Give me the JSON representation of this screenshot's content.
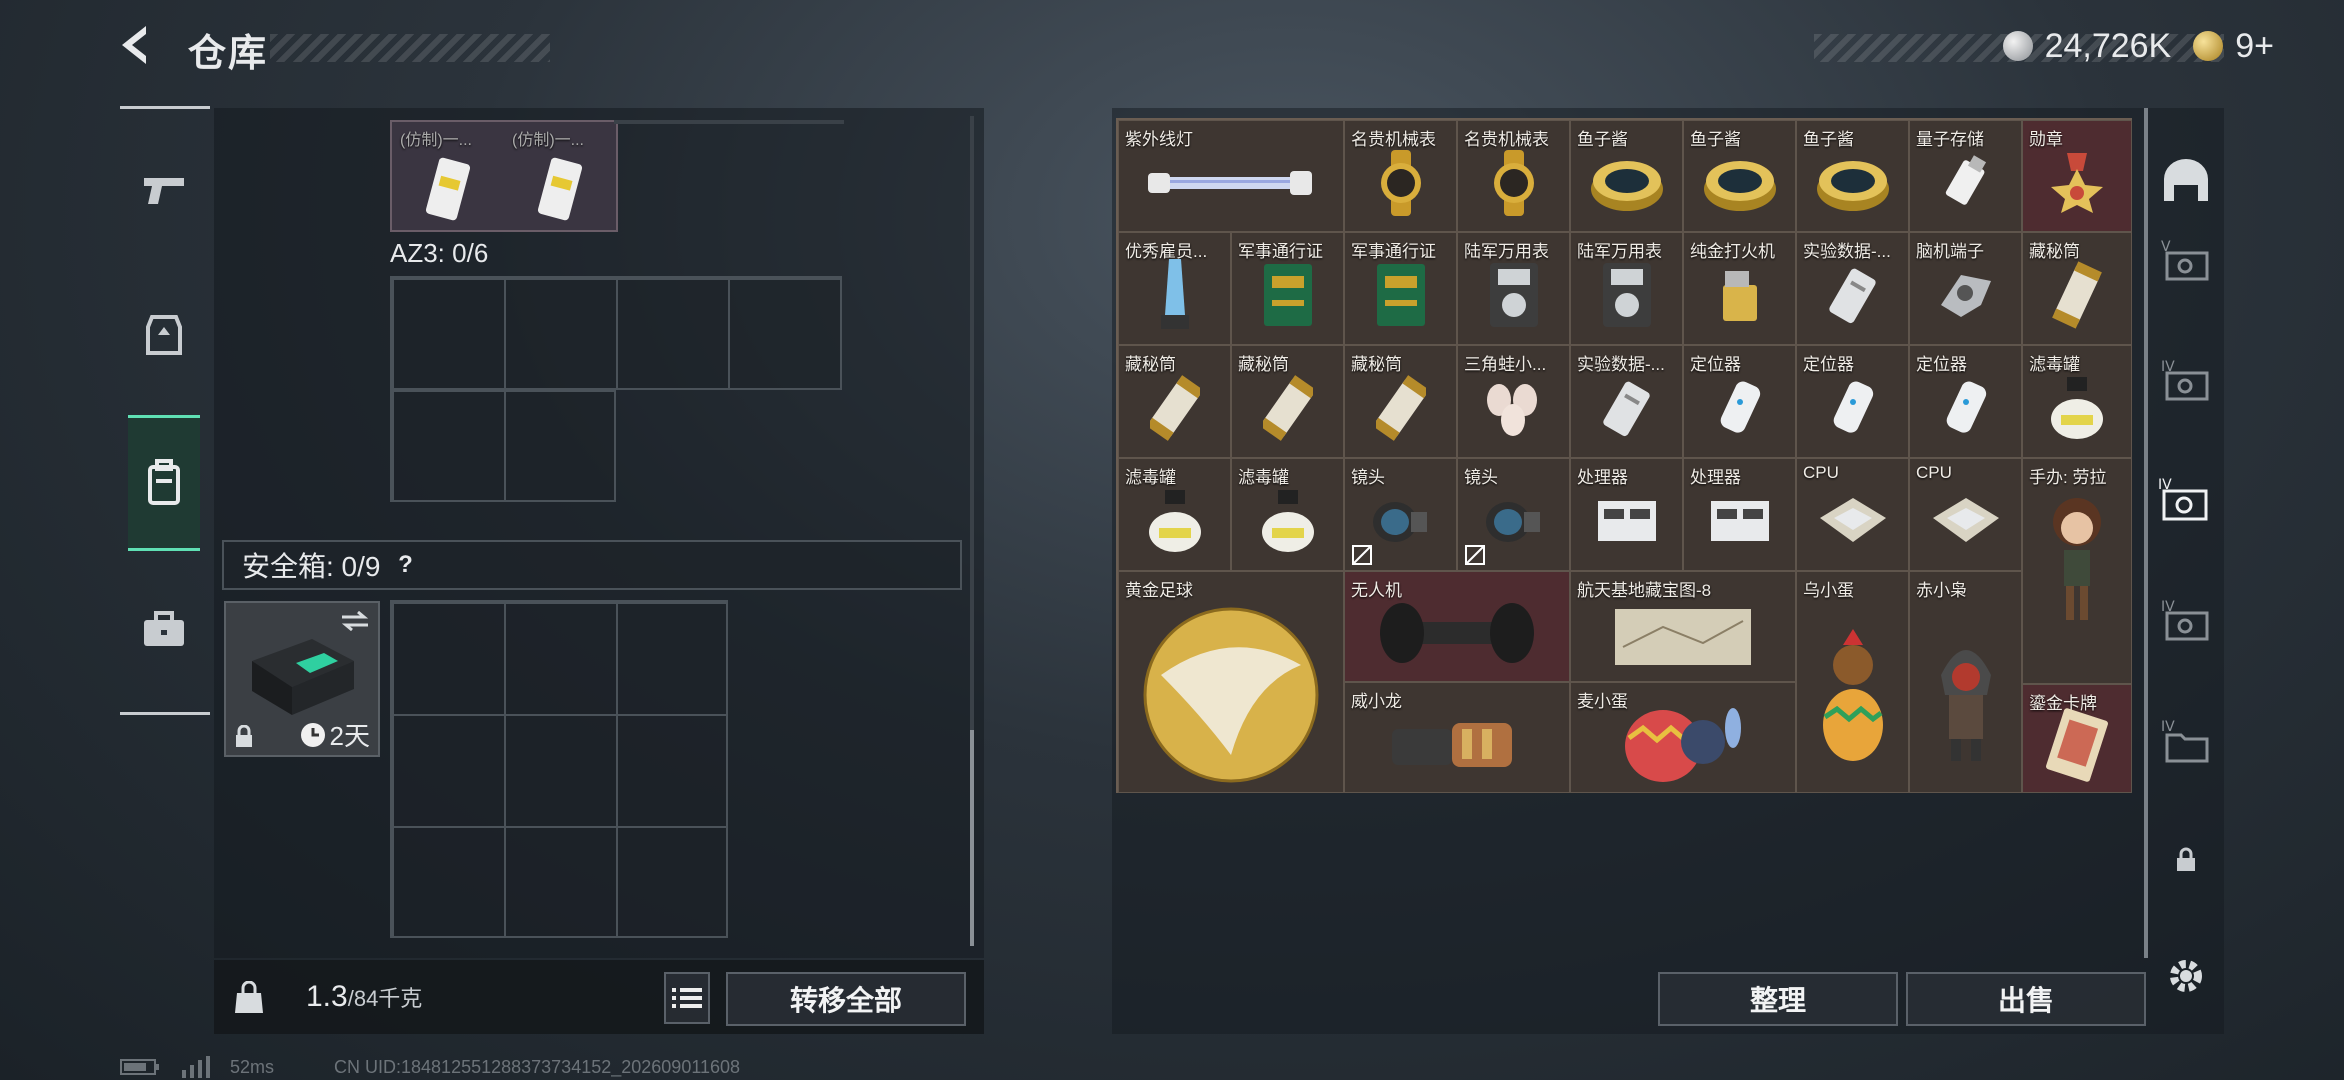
{
  "header": {
    "title": "仓库",
    "silver_amount": "24,726K",
    "gold_amount": "9+"
  },
  "left": {
    "top_items": [
      {
        "label": "(仿制)一..."
      },
      {
        "label": "(仿制)一..."
      }
    ],
    "az3_label": "AZ3: 0/6",
    "safe_label": "安全箱: 0/9",
    "safe_help": "?",
    "safe_timer": "2天",
    "weight_value": "1.3",
    "weight_max": "/84千克",
    "transfer_all": "转移全部"
  },
  "inventory": {
    "items": [
      {
        "name": "紫外线灯"
      },
      {
        "name": "名贵机械表"
      },
      {
        "name": "名贵机械表"
      },
      {
        "name": "鱼子酱"
      },
      {
        "name": "鱼子酱"
      },
      {
        "name": "鱼子酱"
      },
      {
        "name": "量子存储"
      },
      {
        "name": "勋章"
      },
      {
        "name": "优秀雇员..."
      },
      {
        "name": "军事通行证"
      },
      {
        "name": "军事通行证"
      },
      {
        "name": "陆军万用表"
      },
      {
        "name": "陆军万用表"
      },
      {
        "name": "纯金打火机"
      },
      {
        "name": "实验数据-..."
      },
      {
        "name": "脑机端子"
      },
      {
        "name": "藏秘筒"
      },
      {
        "name": "藏秘筒"
      },
      {
        "name": "藏秘筒"
      },
      {
        "name": "藏秘筒"
      },
      {
        "name": "三角蛙小..."
      },
      {
        "name": "实验数据-..."
      },
      {
        "name": "定位器"
      },
      {
        "name": "定位器"
      },
      {
        "name": "定位器"
      },
      {
        "name": "滤毒罐"
      },
      {
        "name": "滤毒罐"
      },
      {
        "name": "滤毒罐"
      },
      {
        "name": "镜头"
      },
      {
        "name": "镜头"
      },
      {
        "name": "处理器"
      },
      {
        "name": "处理器"
      },
      {
        "name": "CPU"
      },
      {
        "name": "CPU"
      },
      {
        "name": "手办: 劳拉"
      },
      {
        "name": "黄金足球"
      },
      {
        "name": "无人机"
      },
      {
        "name": "航天基地藏宝图-8"
      },
      {
        "name": "乌小蛋"
      },
      {
        "name": "赤小枭"
      },
      {
        "name": "威小龙"
      },
      {
        "name": "麦小蛋"
      },
      {
        "name": "鎏金卡牌"
      }
    ],
    "sort_button": "整理",
    "sell_button": "出售"
  },
  "footer": {
    "ping": "52ms",
    "uid": "CN UID:184812551288373734152_202609011608"
  },
  "colors": {
    "accent": "#5fe0b4",
    "cell_bg": "#3e3631",
    "red_cell": "#4e2c30"
  }
}
